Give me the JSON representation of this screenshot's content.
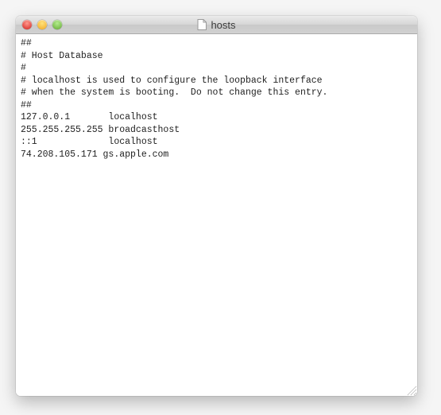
{
  "window": {
    "title": "hosts"
  },
  "content": {
    "lines": [
      "##",
      "# Host Database",
      "#",
      "# localhost is used to configure the loopback interface",
      "# when the system is booting.  Do not change this entry.",
      "##",
      "127.0.0.1       localhost",
      "255.255.255.255 broadcasthost",
      "::1             localhost",
      "74.208.105.171 gs.apple.com"
    ]
  }
}
